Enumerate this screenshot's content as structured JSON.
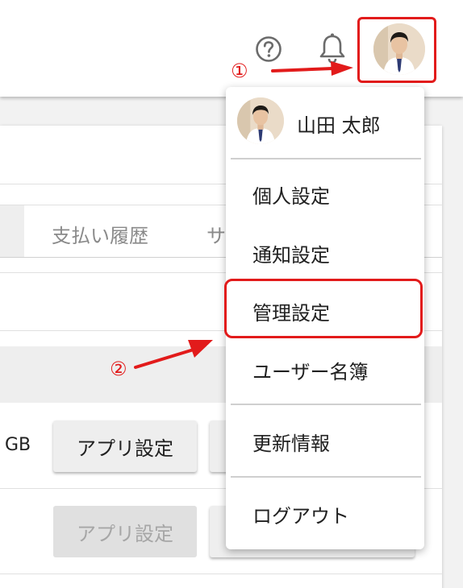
{
  "header": {
    "help_icon": "question-circle-icon",
    "bell_icon": "bell-icon",
    "avatar_icon": "user-avatar"
  },
  "background": {
    "tabs": [
      "支払い履歴",
      "サ"
    ],
    "storage_unit": "GB",
    "buttons": {
      "app_settings": "アプリ設定",
      "app_settings_disabled": "アプリ設定"
    }
  },
  "menu": {
    "user_name": "山田 太郎",
    "items": [
      {
        "label": "個人設定"
      },
      {
        "label": "通知設定"
      },
      {
        "label": "管理設定"
      },
      {
        "label": "ユーザー名簿"
      },
      {
        "label": "更新情報"
      },
      {
        "label": "ログアウト"
      }
    ]
  },
  "annotations": {
    "step1": "①",
    "step2": "②",
    "color": "#e21b1b"
  }
}
